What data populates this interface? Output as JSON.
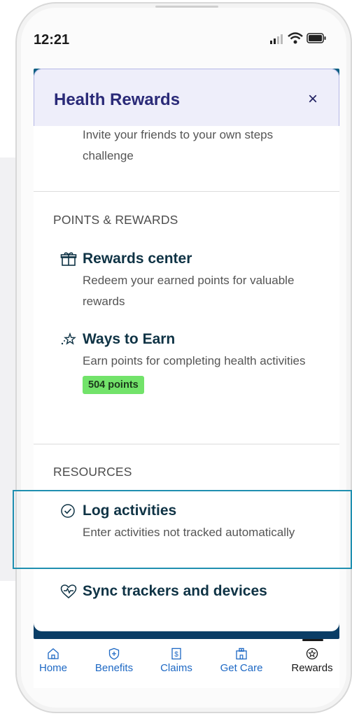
{
  "status_bar": {
    "time": "12:21"
  },
  "sheet": {
    "title": "Health Rewards",
    "close_label": "×",
    "intro_text": "Invite your friends to your own steps challenge"
  },
  "sections": [
    {
      "label": "POINTS & REWARDS",
      "items": [
        {
          "title": "Rewards center",
          "description": "Redeem your earned points for valuable rewards",
          "icon": "gift-icon"
        },
        {
          "title": "Ways to Earn",
          "description": "Earn points for completing health activities",
          "icon": "sparkle-star-icon",
          "badge": "504 points"
        }
      ]
    },
    {
      "label": "RESOURCES",
      "items": [
        {
          "title": "Log activities",
          "description": "Enter activities not tracked automatically",
          "icon": "check-circle-icon"
        },
        {
          "title": "Sync trackers and devices",
          "icon": "heart-pulse-icon"
        }
      ]
    }
  ],
  "tabs": [
    {
      "label": "Home",
      "icon": "home-icon"
    },
    {
      "label": "Benefits",
      "icon": "shield-plus-icon"
    },
    {
      "label": "Claims",
      "icon": "dollar-document-icon"
    },
    {
      "label": "Get Care",
      "icon": "hospital-icon"
    },
    {
      "label": "Rewards",
      "icon": "rewards-star-icon",
      "active": true
    }
  ],
  "colors": {
    "accent_blue": "#1d68c4",
    "title_navy": "#2a2a78",
    "badge_green": "#72e36a",
    "highlight_border": "#1f8fb0"
  }
}
